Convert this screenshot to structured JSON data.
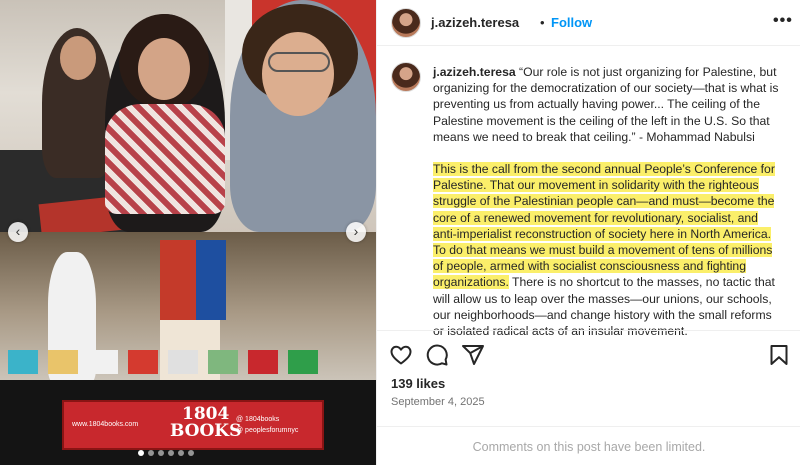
{
  "post": {
    "username": "j.azizeh.teresa",
    "separator": "•",
    "follow_label": "Follow",
    "more_label": "•••"
  },
  "caption": {
    "username": "j.azizeh.teresa",
    "quote": " “Our role is not just organizing for Palestine, but organizing for the democratization of our society—that is what is preventing us from actually having power... The ceiling of the Palestine movement is the ceiling of the left in the U.S. So that means we need to break that ceiling.” - Mohammad Nabulsi",
    "highlighted": "This is the call from the second annual People’s Conference for Palestine. That our movement in solidarity with the righteous struggle of the Palestinian people can—and must—become the core of a renewed movement for revolutionary, socialist, and anti-imperialist reconstruction of society here in North America. To do that means we must build a movement of tens of millions of people, armed with socialist consciousness and fighting organizations.",
    "rest": " There is no shortcut to the masses, no tactic that will allow us to leap over the masses—our unions, our schools, our neighborhoods—and change history with the small reforms or isolated radical acts of an insular movement."
  },
  "media": {
    "banner": {
      "website": "www.1804books.com",
      "logo_line1": "1804",
      "logo_line2": "BOOKS",
      "handle1": "@ 1804books",
      "handle2": "@ peoplesforumnyc"
    },
    "prev_label": "‹",
    "next_label": "›",
    "slide_count": 6,
    "active_slide": 1
  },
  "actions": {
    "like_icon": "heart-icon",
    "comment_icon": "comment-icon",
    "share_icon": "share-icon",
    "save_icon": "bookmark-icon"
  },
  "stats": {
    "likes": "139 likes",
    "date": "September 4, 2025"
  },
  "comments": {
    "limited_text": "Comments on this post have been limited."
  },
  "colors": {
    "accent": "#0095f6",
    "highlight": "#fbef6a",
    "text": "#262626",
    "muted": "#737373"
  }
}
